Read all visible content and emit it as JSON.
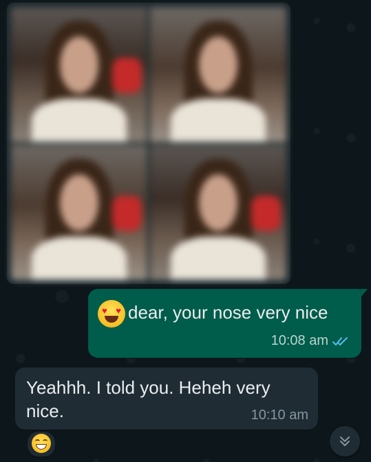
{
  "chat": {
    "media_message": {
      "image_count": 4
    },
    "outgoing_message": {
      "emoji": "heart-eyes-emoji",
      "text": "dear, your nose very nice",
      "time": "10:08 am",
      "status": "read",
      "status_icon": "double-check-icon"
    },
    "incoming_message": {
      "text": "Yeahhh. I told you. Heheh very nice.",
      "time": "10:10 am",
      "reaction": "grinning-face-emoji"
    },
    "scroll_button": {
      "icon": "double-chevron-down-icon"
    }
  },
  "colors": {
    "background": "#0b1418",
    "outgoing_bubble": "#005c4b",
    "incoming_bubble": "#1f2c34",
    "read_ticks": "#53bdeb"
  }
}
